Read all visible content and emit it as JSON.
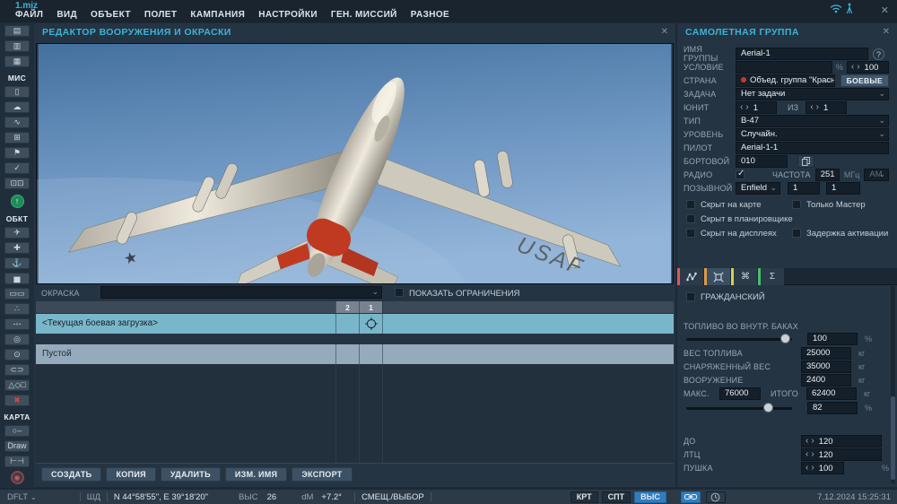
{
  "window": {
    "filename": "1.miz",
    "close_glyph": "✕"
  },
  "menu": {
    "items": [
      "ФАЙЛ",
      "ВИД",
      "ОБЪЕКТ",
      "ПОЛЕТ",
      "КАМПАНИЯ",
      "НАСТРОЙКИ",
      "ГЕН. МИССИЙ",
      "РАЗНОЕ"
    ]
  },
  "icons": {
    "chevron_down": "⌄",
    "chevron_left": "‹",
    "chevron_right": "›",
    "check": "✓",
    "help": "?",
    "up_arrow": "↑"
  },
  "sidebar": {
    "file_icons": [
      {
        "name": "new-mission",
        "glyph": "▤"
      },
      {
        "name": "open-mission",
        "glyph": "▥"
      },
      {
        "name": "save-mission",
        "glyph": "▦"
      }
    ],
    "mission_label": "МИС",
    "mission_icons": [
      {
        "name": "briefing",
        "glyph": "▯"
      },
      {
        "name": "weather",
        "glyph": "☁"
      },
      {
        "name": "sling-load",
        "glyph": "∿"
      },
      {
        "name": "bullseye",
        "glyph": "⊞"
      },
      {
        "name": "goals",
        "glyph": "⚑"
      },
      {
        "name": "mission-check",
        "glyph": "✓"
      },
      {
        "name": "triggers",
        "glyph": "⊡⊡"
      }
    ],
    "objects_label": "ОБКТ",
    "object_icons": [
      {
        "name": "airplane",
        "glyph": "✈"
      },
      {
        "name": "helicopter",
        "glyph": "✚"
      },
      {
        "name": "ship",
        "glyph": "⚓"
      },
      {
        "name": "vehicle",
        "glyph": "▅"
      },
      {
        "name": "train",
        "glyph": "▭▭"
      },
      {
        "name": "infantry",
        "glyph": "∴"
      },
      {
        "name": "static-object",
        "glyph": "-◦-"
      },
      {
        "name": "airfield",
        "glyph": "◎"
      },
      {
        "name": "heliport",
        "glyph": "⊙"
      },
      {
        "name": "farp",
        "glyph": "⊂⊃"
      },
      {
        "name": "shapes",
        "glyph": "△◇□"
      },
      {
        "name": "delete",
        "glyph": "✖"
      }
    ],
    "map_label": "КАРТА",
    "map_icons": [
      {
        "name": "key",
        "glyph": "○‒"
      },
      {
        "name": "draw",
        "glyph": "Draw"
      },
      {
        "name": "ruler",
        "glyph": "⊢⊣"
      }
    ],
    "logo_glyph": "◉"
  },
  "editor": {
    "title": "РЕДАКТОР ВООРУЖЕНИЯ И ОКРАСКИ",
    "paint": {
      "label": "ОКРАСКА",
      "value": ""
    },
    "show_limits_label": "ПОКАЗАТЬ ОГРАНИЧЕНИЯ",
    "loadout_columns": [
      "2",
      "1"
    ],
    "loadout_rows": [
      {
        "name": "<Текущая боевая загрузка>"
      },
      {
        "name": "Пустой"
      }
    ],
    "buttons": [
      "СОЗДАТЬ",
      "КОПИЯ",
      "УДАЛИТЬ",
      "ИЗМ. ИМЯ",
      "ЭКСПОРТ"
    ],
    "viewport": {
      "aircraft_type": "B-47",
      "wing_text": "USAF",
      "sky_top": "#44709f",
      "sky_bottom": "#93b5d9",
      "tail_color": "#c03a22"
    }
  },
  "group_panel": {
    "title": "САМОЛЕТНАЯ ГРУППА",
    "name": {
      "label": "ИМЯ ГРУППЫ",
      "value": "Aerial-1"
    },
    "condition": {
      "label": "УСЛОВИЕ",
      "value": "",
      "percent": "%",
      "spinner": "100"
    },
    "country": {
      "label": "СТРАНА",
      "value": "Объед. группа \"Красные\"",
      "combat_button": "БОЕВЫЕ",
      "dot_color": "#c23a30"
    },
    "task": {
      "label": "ЗАДАЧА",
      "value": "Нет задачи"
    },
    "unit": {
      "label": "ЮНИТ",
      "value": "1",
      "of_label": "ИЗ",
      "of_value": "1"
    },
    "type": {
      "label": "ТИП",
      "value": "B-47"
    },
    "skill": {
      "label": "УРОВЕНЬ",
      "value": "Случайн."
    },
    "pilot": {
      "label": "ПИЛОТ",
      "value": "Aerial-1-1"
    },
    "tail_number": {
      "label": "БОРТОВОЙ",
      "value": "010"
    },
    "radio": {
      "label": "РАДИО",
      "freq_label": "ЧАСТОТА",
      "freq": "251",
      "unit": "МГц",
      "modulation": "АМ"
    },
    "callsign": {
      "label": "ПОЗЫВНОЙ",
      "value": "Enfield",
      "num1": "1",
      "num2": "1"
    },
    "checkboxes": {
      "hidden_map": "Скрыт на карте",
      "master_only": "Только Мастер",
      "hidden_planner": "Скрыт в планировщике",
      "hidden_mfd": "Скрыт на дисплеях",
      "late_activation": "Задержка активации",
      "civilian": "ГРАЖДАНСКИЙ"
    },
    "tabs": [
      {
        "name": "route",
        "color": "#e0565c"
      },
      {
        "name": "payload",
        "color": "#dd9a45"
      },
      {
        "name": "actions",
        "glyph": "⌘",
        "color": "#d8cf4e"
      },
      {
        "name": "summary",
        "glyph": "Σ",
        "color": "#49bf69"
      }
    ],
    "fuel": {
      "label": "ТОПЛИВО ВО ВНУТР. БАКАХ",
      "value": "100",
      "unit": "%"
    },
    "fuel_weight": {
      "label": "ВЕС ТОПЛИВА",
      "value": "25000",
      "unit": "кг"
    },
    "empty_weight": {
      "label": "СНАРЯЖЕННЫЙ ВЕС",
      "value": "35000",
      "unit": "кг"
    },
    "weapons_weight": {
      "label": "ВООРУЖЕНИЕ",
      "value": "2400",
      "unit": "кг"
    },
    "max_weight": {
      "label": "МАКС.",
      "value": "76000",
      "total_label": "ИТОГО",
      "total": "62400",
      "unit": "кг"
    },
    "weight_percent": {
      "value": "82",
      "unit": "%"
    },
    "chaff": {
      "label": "ДО",
      "value": "120"
    },
    "flares": {
      "label": "ЛТЦ",
      "value": "120"
    },
    "gun": {
      "label": "ПУШКА",
      "value": "100",
      "unit": "%"
    }
  },
  "status_bar": {
    "layer": "DFLT",
    "coord_label": "ШД",
    "coords": "N 44°58'55\", E 39°18'20\"",
    "alt_label": "ВЫС",
    "alt_value": "26",
    "dm_label": "dM",
    "dm_value": "+7.2°",
    "offset_label": "СМЕЩ./ВЫБОР",
    "buttons": [
      "КРТ",
      "СПТ",
      "ВЫС"
    ],
    "datetime": "7.12.2024 15:25:31"
  }
}
